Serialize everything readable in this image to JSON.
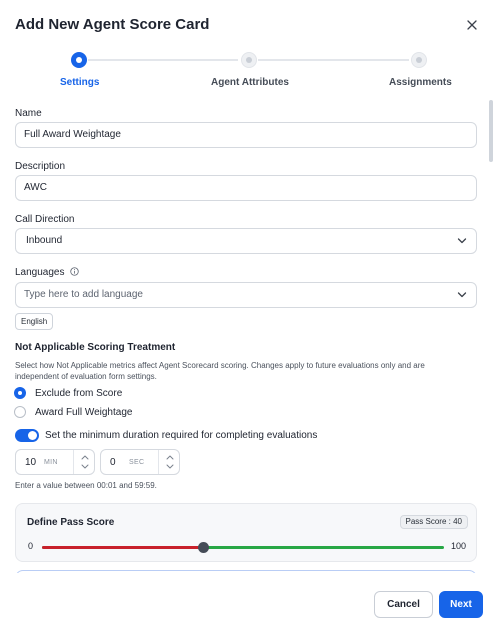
{
  "dialog": {
    "title": "Add New Agent Score Card",
    "close_icon": "close-icon"
  },
  "stepper": {
    "steps": [
      {
        "label": "Settings",
        "state": "active"
      },
      {
        "label": "Agent Attributes",
        "state": "inactive"
      },
      {
        "label": "Assignments",
        "state": "inactive"
      }
    ]
  },
  "form": {
    "name": {
      "label": "Name",
      "value": "Full Award Weightage"
    },
    "description": {
      "label": "Description",
      "value": "AWC"
    },
    "call_direction": {
      "label": "Call Direction",
      "value": "Inbound",
      "icon": "chevron-down-icon"
    },
    "languages": {
      "label": "Languages",
      "info_icon": "info-icon",
      "placeholder": "Type here to add language",
      "selected": [
        "English"
      ]
    },
    "not_applicable": {
      "title": "Not Applicable Scoring Treatment",
      "help": "Select how Not Applicable metrics affect Agent Scorecard scoring. Changes apply to future evaluations only and are independent of evaluation form settings.",
      "options": [
        {
          "label": "Exclude from Score",
          "selected": true
        },
        {
          "label": "Award Full Weightage",
          "selected": false
        }
      ]
    },
    "min_duration": {
      "enabled": true,
      "label": "Set the minimum duration required for completing evaluations",
      "minutes": {
        "value": "10",
        "unit": "MIN"
      },
      "seconds": {
        "value": "0",
        "unit": "SEC"
      },
      "hint": "Enter a value between 00:01 and 59:59."
    },
    "pass_score": {
      "title": "Define Pass Score",
      "badge": "Pass Score : 40",
      "min": "0",
      "max": "100",
      "value": 40,
      "colors": {
        "below": "#c8212b",
        "above": "#27a745",
        "thumb": "#454c57"
      }
    }
  },
  "footer": {
    "cancel_label": "Cancel",
    "next_label": "Next"
  },
  "colors": {
    "accent": "#1764e8"
  }
}
